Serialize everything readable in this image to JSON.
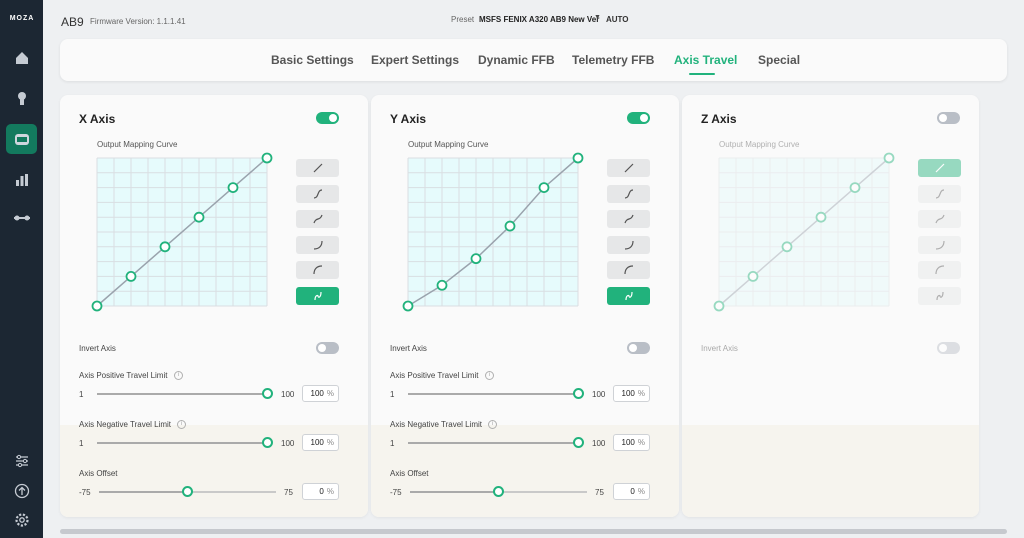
{
  "app": {
    "logo_text": "MOZA"
  },
  "sidebar": {
    "top_items": [
      {
        "icon": "home-icon"
      },
      {
        "icon": "base-icon"
      },
      {
        "icon": "device-icon"
      },
      {
        "icon": "dashboard-icon"
      },
      {
        "icon": "pedals-icon"
      }
    ],
    "bottom_items": [
      {
        "icon": "sliders-icon"
      },
      {
        "icon": "upload-icon"
      },
      {
        "icon": "gear-icon"
      }
    ],
    "active_index": 2
  },
  "header": {
    "device_name": "AB9",
    "firmware_label": "Firmware Version: 1.1.1.41",
    "preset_label": "Preset",
    "preset_value": "MSFS FENIX A320 AB9 New Ver",
    "preset_caret": "▼",
    "preset_auto": "AUTO"
  },
  "tabs": [
    "Basic Settings",
    "Expert Settings",
    "Dynamic FFB",
    "Telemetry FFB",
    "Axis Travel",
    "Special"
  ],
  "active_tab": "Axis Travel",
  "colors": {
    "accent": "#21b27c",
    "sidebar": "#1c2733",
    "grid_fill": "#e6fbfc"
  },
  "axes": [
    {
      "title": "X Axis",
      "enabled": true,
      "curve_label": "Output Mapping Curve",
      "curve_points": [
        [
          0,
          0
        ],
        [
          20,
          20
        ],
        [
          40,
          40
        ],
        [
          60,
          60
        ],
        [
          80,
          80
        ],
        [
          100,
          100
        ]
      ],
      "curve_presets": [
        "linear",
        "s-curve",
        "wave",
        "exponential",
        "logarithmic",
        "custom"
      ],
      "active_preset": "custom",
      "invert_label": "Invert Axis",
      "invert": false,
      "positive_limit": {
        "label": "Axis Positive Travel Limit",
        "min": "1",
        "max": "100",
        "value": "100",
        "unit": "%"
      },
      "negative_limit": {
        "label": "Axis Negative Travel Limit",
        "min": "1",
        "max": "100",
        "value": "100",
        "unit": "%"
      },
      "offset": {
        "label": "Axis Offset",
        "min": "-75",
        "max": "75",
        "value": "0",
        "unit": "%"
      }
    },
    {
      "title": "Y Axis",
      "enabled": true,
      "curve_label": "Output Mapping Curve",
      "curve_points": [
        [
          0,
          0
        ],
        [
          20,
          14
        ],
        [
          40,
          32
        ],
        [
          60,
          54
        ],
        [
          80,
          80
        ],
        [
          100,
          100
        ]
      ],
      "curve_presets": [
        "linear",
        "s-curve",
        "wave",
        "exponential",
        "logarithmic",
        "custom"
      ],
      "active_preset": "custom",
      "invert_label": "Invert Axis",
      "invert": false,
      "positive_limit": {
        "label": "Axis Positive Travel Limit",
        "min": "1",
        "max": "100",
        "value": "100",
        "unit": "%"
      },
      "negative_limit": {
        "label": "Axis Negative Travel Limit",
        "min": "1",
        "max": "100",
        "value": "100",
        "unit": "%"
      },
      "offset": {
        "label": "Axis Offset",
        "min": "-75",
        "max": "75",
        "value": "0",
        "unit": "%"
      }
    },
    {
      "title": "Z Axis",
      "enabled": false,
      "curve_label": "Output Mapping Curve",
      "curve_points": [
        [
          0,
          0
        ],
        [
          20,
          20
        ],
        [
          40,
          40
        ],
        [
          60,
          60
        ],
        [
          80,
          80
        ],
        [
          100,
          100
        ]
      ],
      "curve_presets": [
        "linear",
        "s-curve",
        "wave",
        "exponential",
        "logarithmic",
        "custom"
      ],
      "active_preset": "linear",
      "invert_label": "Invert Axis",
      "invert": false
    }
  ]
}
